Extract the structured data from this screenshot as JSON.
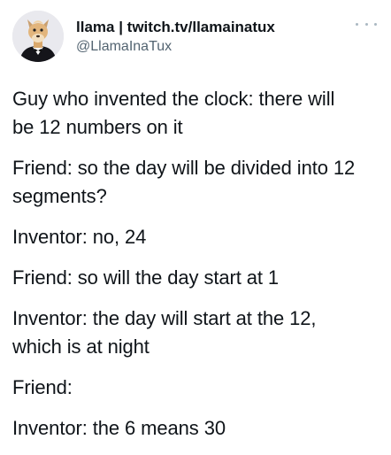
{
  "author": {
    "display_name": "llama | twitch.tv/llamainatux",
    "handle": "@LlamaInaTux",
    "avatar_icon": "llama-avatar-icon"
  },
  "menu": {
    "icon": "more-options-icon"
  },
  "tweet": {
    "lines": [
      [
        "Guy who invented the clock: there will",
        "be 12 numbers on it"
      ],
      [
        "Friend: so the day will be divided into 12",
        "segments?"
      ],
      [
        "Inventor: no, 24"
      ],
      [
        "Friend: so will the day start at 1"
      ],
      [
        "Inventor: the day will start at the 12,",
        "which is at night"
      ],
      [
        "Friend:"
      ],
      [
        "Inventor: the 6 means 30"
      ]
    ]
  }
}
